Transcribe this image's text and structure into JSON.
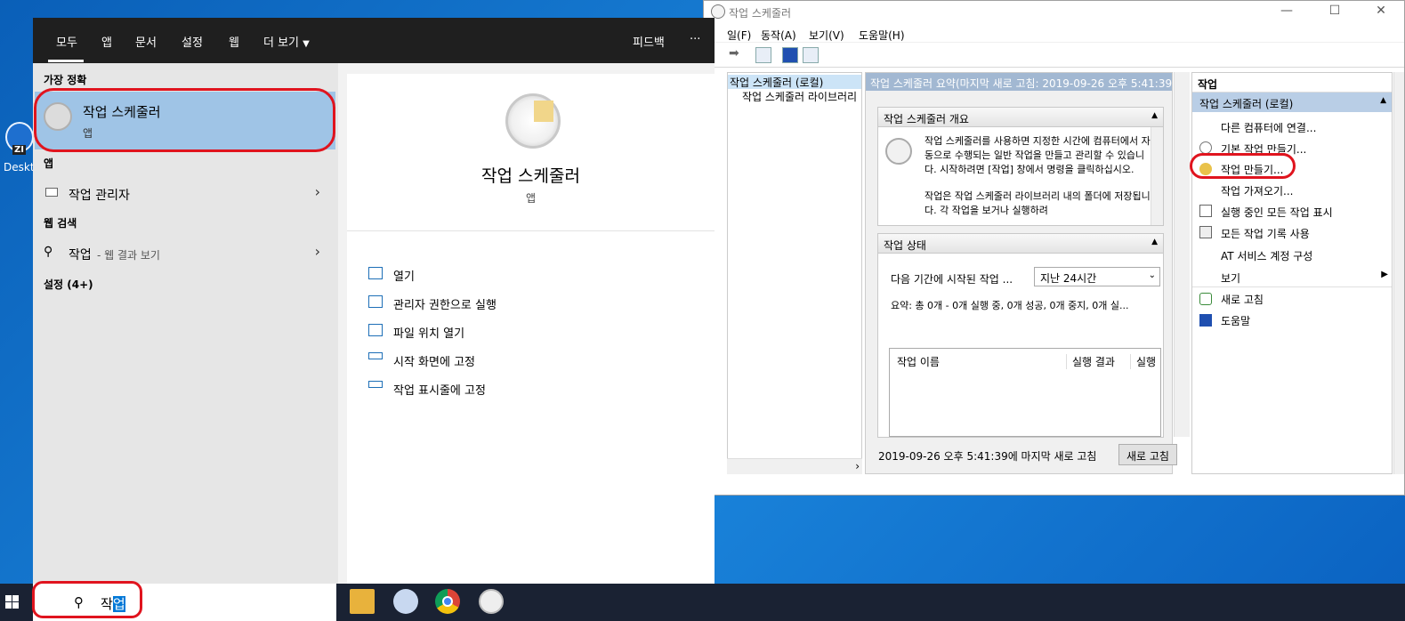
{
  "desktop": {
    "icon_badge": "ZI",
    "icon_label": "Deskto"
  },
  "ts": {
    "title": "작업 스케줄러",
    "window_controls": [
      "—",
      "☐",
      "✕"
    ],
    "menu": [
      "일(F)",
      "동작(A)",
      "보기(V)",
      "도움말(H)"
    ],
    "tree": [
      "작업 스케줄러 (로컬)",
      "작업 스케줄러 라이브러리"
    ],
    "summary_header": "작업 스케줄러 요약(마지막 새로 고침: 2019-09-26 오후 5:41:39)",
    "overview_title": "작업 스케줄러 개요",
    "overview_text1": "작업 스케줄러를 사용하면 지정한 시간에 컴퓨터에서 자동으로 수행되는 일반 작업을 만들고 관리할 수 있습니다. 시작하려면 [작업] 창에서 명령을 클릭하십시오.",
    "overview_text2": "작업은 작업 스케줄러 라이브러리 내의 폴더에 저장됩니다. 각 작업을 보거나 실행하려",
    "status_title": "작업 상태",
    "status_label": "다음 기간에 시작된 작업 ...",
    "status_select": "지난 24시간",
    "status_summary": "요약: 총 0개 - 0개 실행 중, 0개 성공, 0개 중지, 0개 실...",
    "table_headers": [
      "작업 이름",
      "실행 결과",
      "실행"
    ],
    "refresh_text": "2019-09-26 오후 5:41:39에 마지막 새로 고침",
    "refresh_button": "새로 고침",
    "actions_title": "작업",
    "actions_sub": "작업 스케줄러 (로컬)",
    "actions": [
      "다른 컴퓨터에 연결...",
      "기본 작업 만들기...",
      "작업 만들기...",
      "작업 가져오기...",
      "실행 중인 모든 작업 표시",
      "모든 작업 기록 사용",
      "AT 서비스 계정 구성",
      "보기",
      "새로 고침",
      "도움말"
    ]
  },
  "start": {
    "tabs": [
      "모두",
      "앱",
      "문서",
      "설정",
      "웹",
      "더 보기"
    ],
    "feedback": "피드백",
    "more": "···",
    "best_match_label": "가장 정확",
    "best_title": "작업 스케줄러",
    "best_sub": "앱",
    "apps_label": "앱",
    "app_item": "작업 관리자",
    "web_label": "웹 검색",
    "web_item": "작업",
    "web_item_suffix": " - 웹 결과 보기",
    "settings_label": "설정 (4+)",
    "detail_title": "작업 스케줄러",
    "detail_sub": "앱",
    "actions": [
      "열기",
      "관리자 권한으로 실행",
      "파일 위치 열기",
      "시작 화면에 고정",
      "작업 표시줄에 고정"
    ]
  },
  "taskbar": {
    "query_prefix": "작",
    "query_selected": "업"
  }
}
